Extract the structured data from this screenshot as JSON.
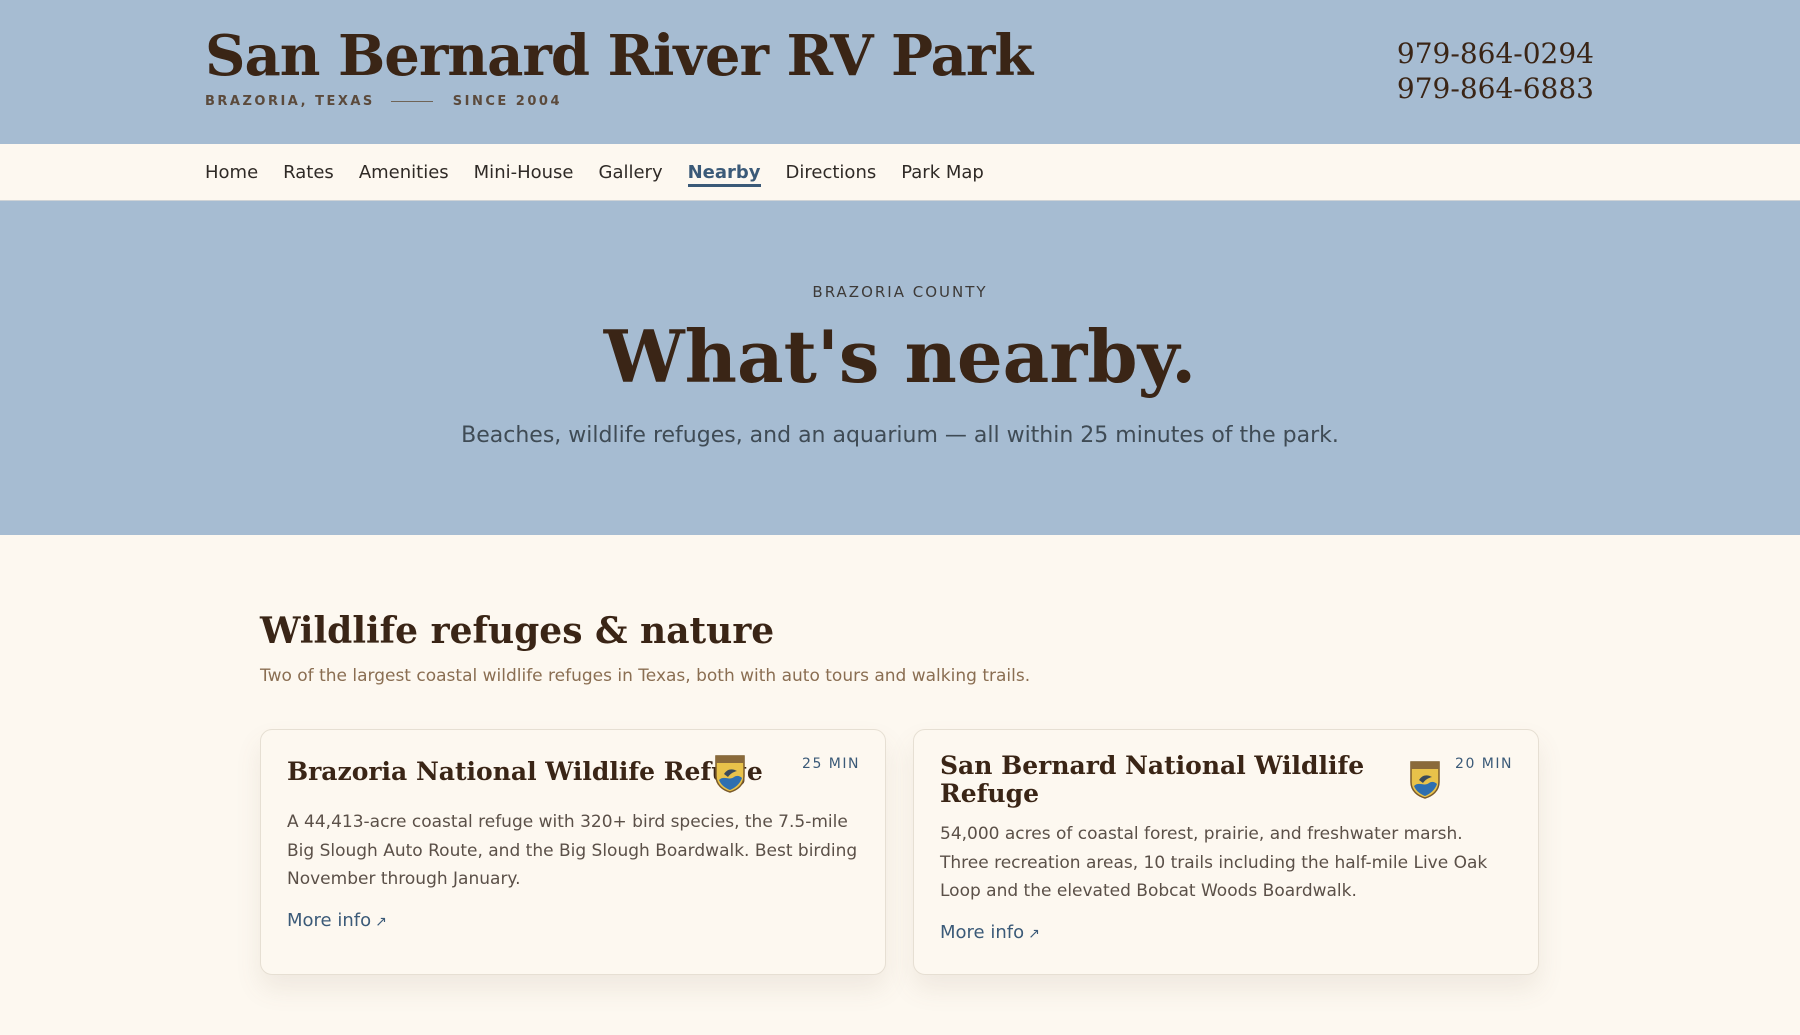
{
  "header": {
    "title": "San Bernard River RV Park",
    "location": "BRAZORIA, TEXAS",
    "since": "SINCE 2004",
    "phones": [
      "979-864-0294",
      "979-864-6883"
    ]
  },
  "nav": {
    "items": [
      "Home",
      "Rates",
      "Amenities",
      "Mini-House",
      "Gallery",
      "Nearby",
      "Directions",
      "Park Map"
    ],
    "active": "Nearby"
  },
  "hero": {
    "kicker": "BRAZORIA COUNTY",
    "title": "What's nearby.",
    "subtitle": "Beaches, wildlife refuges, and an aquarium — all within 25 minutes of the park."
  },
  "section": {
    "title": "Wildlife refuges & nature",
    "subtitle": "Two of the largest coastal wildlife refuges in Texas, both with auto tours and walking trails.",
    "cards": [
      {
        "title": "Brazoria National Wildlife Refuge",
        "time": "25 MIN",
        "body": "A 44,413-acre coastal refuge with 320+ bird species, the 7.5-mile Big Slough Auto Route, and the Big Slough Boardwalk. Best birding November through January.",
        "link": "More info",
        "link_icon": "external-arrow-icon"
      },
      {
        "title": "San Bernard National Wildlife Refuge",
        "time": "20 MIN",
        "body": "54,000 acres of coastal forest, prairie, and freshwater marsh. Three recreation areas, 10 trails including the half-mile Live Oak Loop and the elevated Bobcat Woods Boardwalk.",
        "link": "More info",
        "link_icon": "external-arrow-icon"
      }
    ]
  },
  "colors": {
    "header_bg": "#a6bcd2",
    "page_bg": "#fdf8f0",
    "heading": "#3a2516",
    "accent": "#3b5a78"
  }
}
